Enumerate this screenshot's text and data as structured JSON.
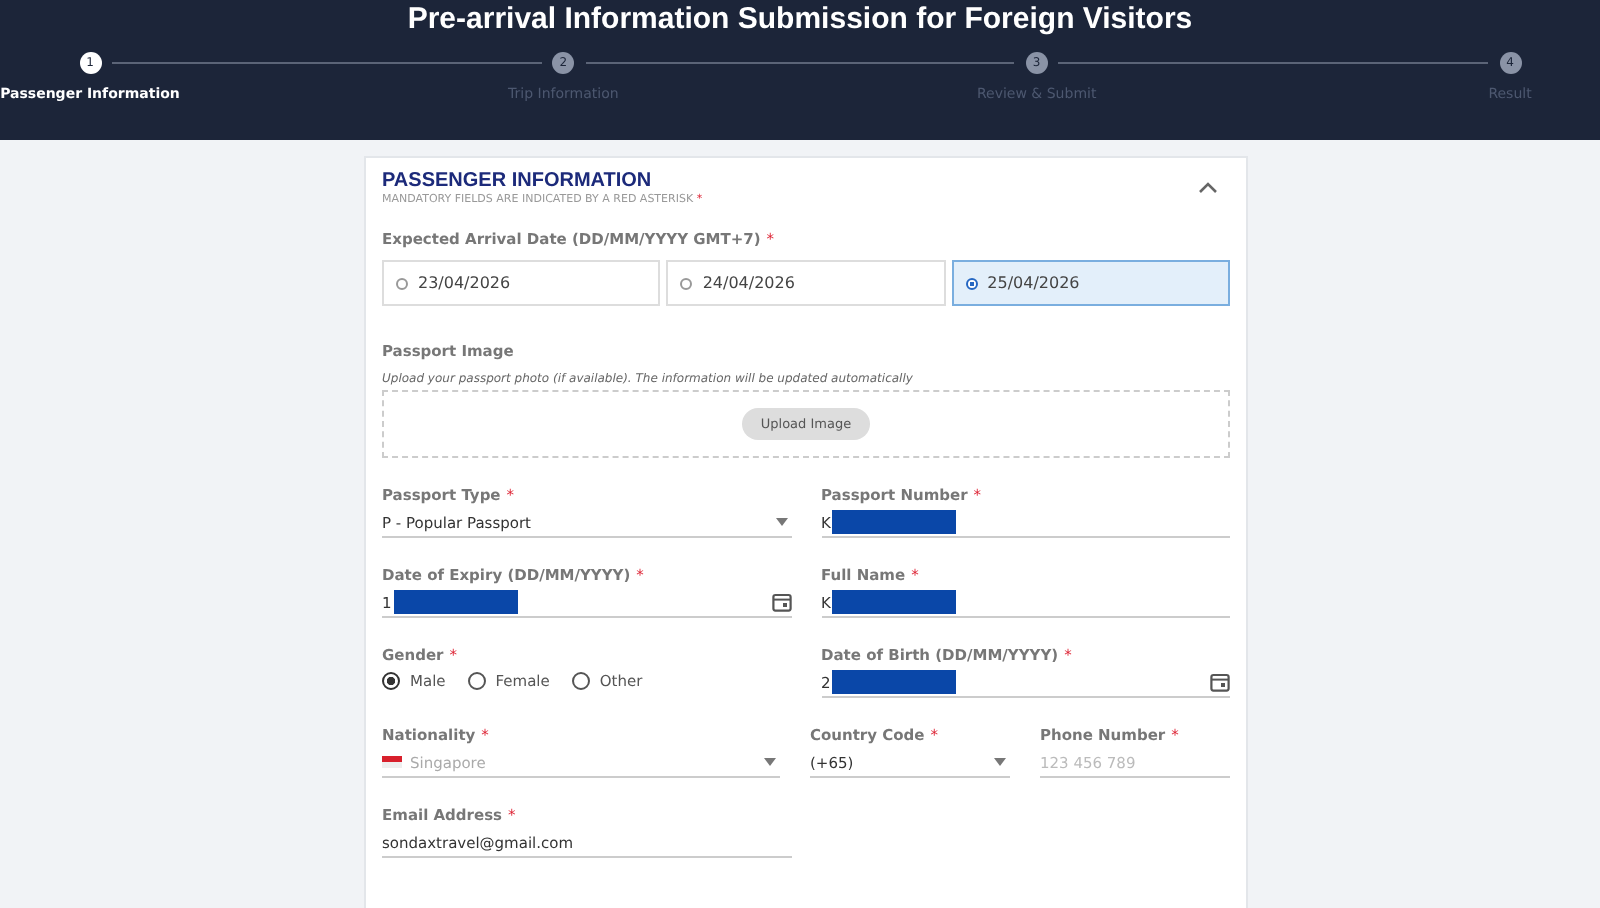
{
  "header": {
    "title": "Pre-arrival Information Submission for Foreign Visitors"
  },
  "steps": [
    {
      "number": "1",
      "label": "Passenger Information",
      "selected": true
    },
    {
      "number": "2",
      "label": "Trip Information",
      "selected": false
    },
    {
      "number": "3",
      "label": "Review & Submit",
      "selected": false
    },
    {
      "number": "4",
      "label": "Result",
      "selected": false
    }
  ],
  "section": {
    "title": "PASSENGER INFORMATION",
    "subtitle": "MANDATORY FIELDS ARE INDICATED BY A RED ASTERISK",
    "subtitle_mark": "*",
    "expanded": true
  },
  "arrival": {
    "label": "Expected Arrival Date (DD/MM/YYYY GMT+7)",
    "required": true,
    "options": [
      {
        "label": "23/04/2026",
        "selected": false
      },
      {
        "label": "24/04/2026",
        "selected": false
      },
      {
        "label": "25/04/2026",
        "selected": true
      }
    ]
  },
  "passport_image": {
    "label": "Passport Image",
    "hint": "Upload your passport photo (if available). The information will be updated automatically",
    "button": "Upload Image"
  },
  "rows": [
    [
      {
        "kind": "select",
        "label": "Passport Type",
        "required": true,
        "value": "P - Popular Passport"
      },
      {
        "kind": "text",
        "label": "Passport Number",
        "required": true,
        "value": "K",
        "redacted": true
      }
    ],
    [
      {
        "kind": "date",
        "label": "Date of Expiry (DD/MM/YYYY)",
        "required": true,
        "value": "1",
        "redacted": true
      },
      {
        "kind": "text",
        "label": "Full Name",
        "required": true,
        "value": "K",
        "redacted": true
      }
    ],
    [
      {
        "kind": "radio",
        "label": "Gender",
        "required": true,
        "options": [
          {
            "label": "Male",
            "selected": true
          },
          {
            "label": "Female",
            "selected": false
          },
          {
            "label": "Other",
            "selected": false
          }
        ]
      },
      {
        "kind": "date",
        "label": "Date of Birth (DD/MM/YYYY)",
        "required": true,
        "value": "2",
        "redacted": true
      }
    ],
    [
      {
        "kind": "select",
        "label": "Nationality",
        "required": true,
        "value": "Singapore",
        "flag": true,
        "disabled": true
      },
      {
        "kind": "select",
        "label": "Country Code",
        "required": true,
        "value": "(+65)"
      },
      {
        "kind": "text",
        "label": "Phone Number",
        "required": true,
        "placeholder": "123 456 789"
      }
    ],
    [
      {
        "kind": "text",
        "label": "Email Address",
        "required": true,
        "value": "sondaxtravel@gmail.com"
      }
    ]
  ]
}
